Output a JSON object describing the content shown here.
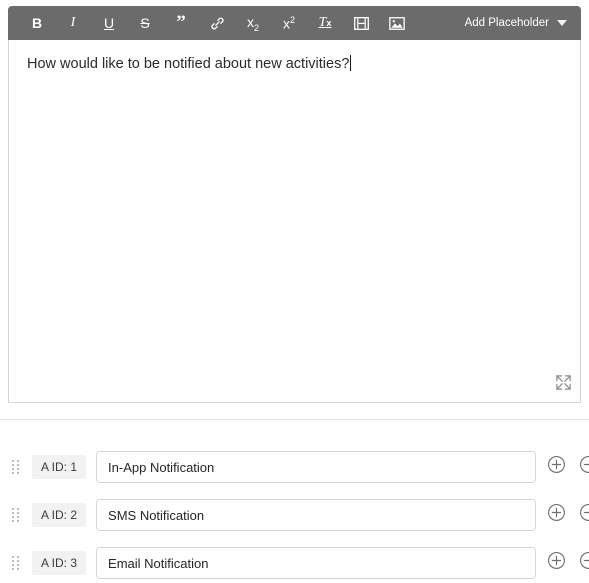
{
  "editor": {
    "toolbar": {
      "buttons": [
        {
          "name": "bold-icon",
          "label": "B"
        },
        {
          "name": "italic-icon",
          "label": "I"
        },
        {
          "name": "underline-icon",
          "label": "U"
        },
        {
          "name": "strikethrough-icon",
          "label": "S"
        },
        {
          "name": "blockquote-icon",
          "label": "”"
        },
        {
          "name": "link-icon",
          "label": "link"
        },
        {
          "name": "subscript-icon",
          "label": "x2"
        },
        {
          "name": "superscript-icon",
          "label": "x2"
        },
        {
          "name": "clear-formatting-icon",
          "label": "Tx"
        },
        {
          "name": "video-icon",
          "label": "video"
        },
        {
          "name": "image-icon",
          "label": "image"
        }
      ],
      "placeholder_menu_label": "Add Placeholder",
      "placeholder_menu_caret": "chevron-down-icon",
      "background_color": "#6b6b6b",
      "icon_color": "#ffffff"
    },
    "content_text": "How would like to be notified about new activities?",
    "caret_visible": true,
    "resize_handle_icon": "expand-diagonal-icon"
  },
  "options": {
    "rows": [
      {
        "drag_handle_icon": "drag-dots-icon",
        "id_label": "A ID: 1",
        "value": "In-App Notification",
        "placeholder": "",
        "add_button_icon": "plus-circle-icon",
        "remove_button_icon": "minus-circle-icon"
      },
      {
        "drag_handle_icon": "drag-dots-icon",
        "id_label": "A ID: 2",
        "value": "SMS Notification",
        "placeholder": "",
        "add_button_icon": "plus-circle-icon",
        "remove_button_icon": "minus-circle-icon"
      },
      {
        "drag_handle_icon": "drag-dots-icon",
        "id_label": "A ID: 3",
        "value": "Email Notification",
        "placeholder": "",
        "add_button_icon": "plus-circle-icon",
        "remove_button_icon": "minus-circle-icon"
      }
    ]
  },
  "colors": {
    "toolbar_bg": "#6b6b6b",
    "page_bg": "#ffffff",
    "border": "#d4d4d4",
    "badge_bg": "#f2f2f2",
    "text": "#2b2b2b"
  }
}
